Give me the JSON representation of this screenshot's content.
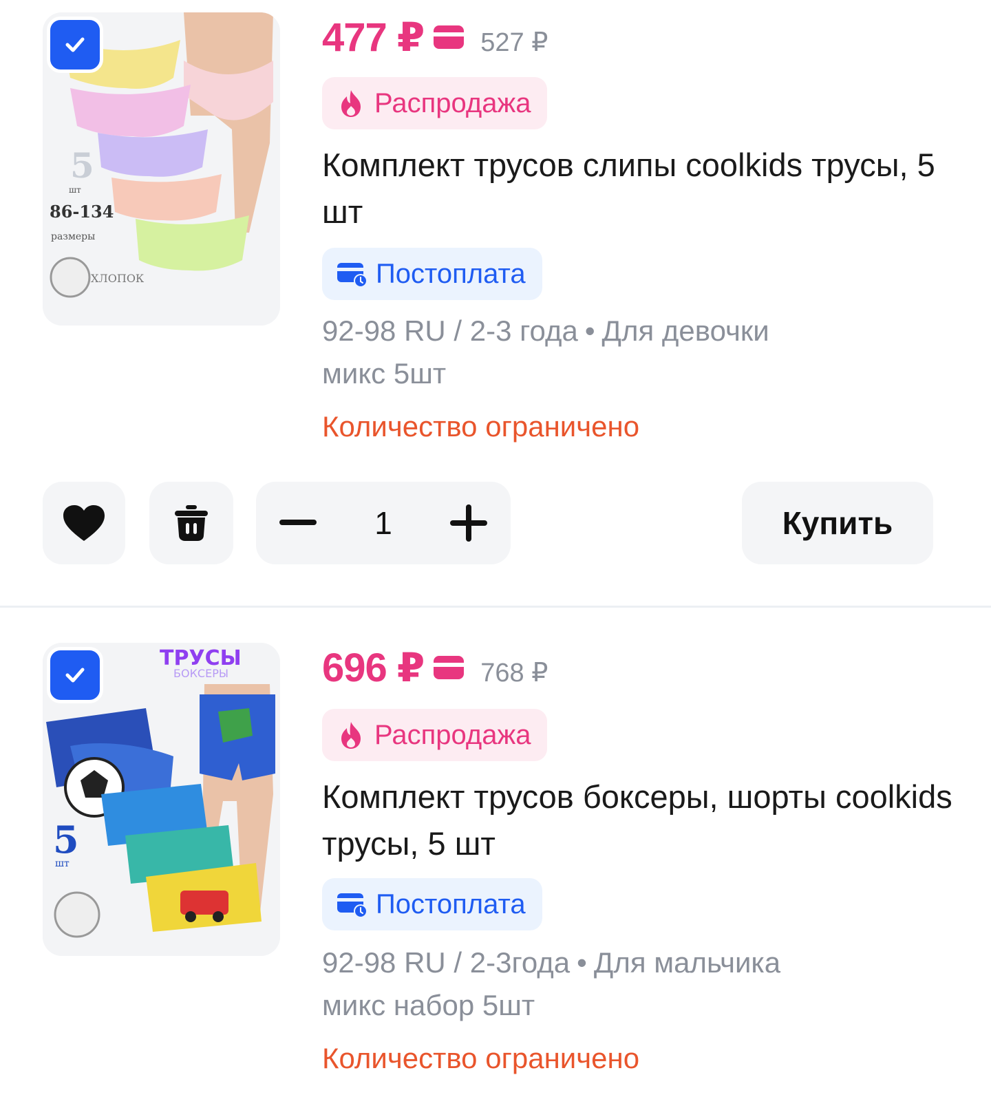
{
  "items": [
    {
      "checked": true,
      "image_alt": "Комплект трусов слипы",
      "price": "477 ₽",
      "old_price": "527 ₽",
      "sale_label": "Распродажа",
      "title": "Комплект трусов слипы coolkids трусы, 5 шт",
      "postpay_label": "Постоплата",
      "meta_line1_a": "92-98 RU / 2-3 года",
      "meta_line1_b": "Для девочки",
      "meta_line2": "микс 5шт",
      "stock_note": "Количество ограничено",
      "quantity": "1",
      "buy_label": "Купить"
    },
    {
      "checked": true,
      "image_alt": "Комплект трусов боксеры",
      "price": "696 ₽",
      "old_price": "768 ₽",
      "sale_label": "Распродажа",
      "title": "Комплект трусов боксеры, шорты coolkids трусы, 5 шт",
      "postpay_label": "Постоплата",
      "meta_line1_a": "92-98 RU / 2-3года",
      "meta_line1_b": "Для мальчика",
      "meta_line2": "микс набор 5шт",
      "stock_note": "Количество ограничено"
    }
  ],
  "icons": {
    "checkbox": "check-icon",
    "price_card": "card-icon",
    "sale": "fire-icon",
    "postpay": "postpay-card-icon",
    "favorite": "heart-icon",
    "delete": "trash-icon",
    "decrement": "minus-icon",
    "increment": "plus-icon"
  },
  "colors": {
    "price": "#e8367f",
    "accent_blue": "#1f5cf2",
    "stock_note": "#e9552c",
    "muted": "#8a8f99"
  }
}
